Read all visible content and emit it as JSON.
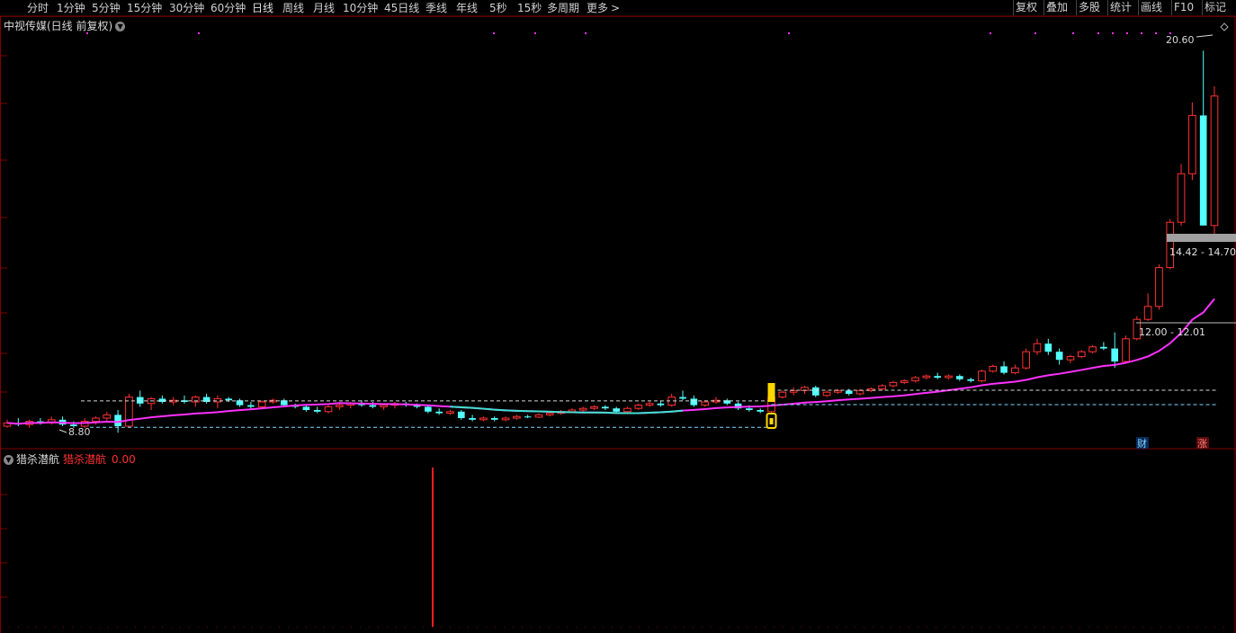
{
  "toolbar": {
    "periods": [
      "分时",
      "1分钟",
      "5分钟",
      "15分钟",
      "30分钟",
      "60分钟",
      "日线",
      "周线",
      "月线",
      "10分钟",
      "45日线",
      "季线",
      "年线",
      "5秒",
      "15秒",
      "多周期",
      "更多"
    ],
    "active_period": "日线",
    "more_chevron": ">",
    "right_buttons": [
      "复权",
      "叠加",
      "多股",
      "统计",
      "画线",
      "F10",
      "标记"
    ]
  },
  "chart": {
    "title": "中视传媒(日线 前复权)"
  },
  "indicator": {
    "name": "猎杀潜航",
    "value_label": "猎杀潜航",
    "value": "0.00"
  },
  "colors": {
    "up": "#ff3232",
    "down": "#54ffff",
    "ma_line": "#ff30ff",
    "ma_line_alt": "#40e0d0",
    "grid": "#800000",
    "dashed_white": "#d8d8d8",
    "dashed_cyan": "#7fd8ff",
    "signal_yellow": "#ffd700",
    "range_box": "#a0a0a0",
    "indicator_bar": "#ff2020"
  },
  "chart_data": {
    "type": "candlestick",
    "annotations": {
      "high_label": "20.60",
      "low_label": "8.80",
      "range_upper": "14.42 - 14.70",
      "range_lower": "12.00 - 12.01",
      "marker_cai": "财",
      "marker_zhang": "涨"
    },
    "price_range": [
      8.5,
      21.0
    ],
    "ohlc": [
      [
        9.0,
        9.2,
        8.95,
        9.1
      ],
      [
        9.1,
        9.25,
        9.0,
        9.05
      ],
      [
        9.05,
        9.2,
        8.95,
        9.15
      ],
      [
        9.15,
        9.25,
        9.05,
        9.1
      ],
      [
        9.1,
        9.3,
        9.05,
        9.2
      ],
      [
        9.2,
        9.3,
        9.0,
        9.05
      ],
      [
        9.05,
        9.15,
        8.95,
        9.0
      ],
      [
        9.0,
        9.25,
        8.95,
        9.15
      ],
      [
        9.15,
        9.3,
        9.05,
        9.25
      ],
      [
        9.25,
        9.45,
        9.15,
        9.35
      ],
      [
        9.35,
        9.5,
        8.8,
        9.0
      ],
      [
        9.0,
        10.0,
        8.95,
        9.9
      ],
      [
        9.9,
        10.1,
        9.6,
        9.7
      ],
      [
        9.7,
        9.9,
        9.5,
        9.85
      ],
      [
        9.85,
        9.95,
        9.7,
        9.75
      ],
      [
        9.75,
        9.9,
        9.65,
        9.8
      ],
      [
        9.8,
        9.95,
        9.7,
        9.75
      ],
      [
        9.75,
        9.95,
        9.6,
        9.9
      ],
      [
        9.9,
        10.0,
        9.7,
        9.75
      ],
      [
        9.75,
        9.95,
        9.55,
        9.85
      ],
      [
        9.85,
        9.9,
        9.75,
        9.8
      ],
      [
        9.8,
        9.85,
        9.6,
        9.65
      ],
      [
        9.65,
        9.75,
        9.5,
        9.6
      ],
      [
        9.6,
        9.8,
        9.55,
        9.75
      ],
      [
        9.75,
        9.85,
        9.7,
        9.8
      ],
      [
        9.8,
        9.85,
        9.6,
        9.65
      ],
      [
        9.65,
        9.7,
        9.55,
        9.6
      ],
      [
        9.6,
        9.65,
        9.45,
        9.5
      ],
      [
        9.5,
        9.6,
        9.4,
        9.45
      ],
      [
        9.45,
        9.65,
        9.4,
        9.6
      ],
      [
        9.6,
        9.7,
        9.5,
        9.65
      ],
      [
        9.65,
        9.75,
        9.55,
        9.7
      ],
      [
        9.7,
        9.8,
        9.6,
        9.65
      ],
      [
        9.65,
        9.75,
        9.55,
        9.6
      ],
      [
        9.6,
        9.7,
        9.5,
        9.65
      ],
      [
        9.65,
        9.75,
        9.55,
        9.7
      ],
      [
        9.7,
        9.75,
        9.6,
        9.65
      ],
      [
        9.65,
        9.7,
        9.55,
        9.6
      ],
      [
        9.6,
        9.65,
        9.4,
        9.45
      ],
      [
        9.45,
        9.55,
        9.35,
        9.4
      ],
      [
        9.4,
        9.5,
        9.35,
        9.45
      ],
      [
        9.45,
        9.5,
        9.2,
        9.25
      ],
      [
        9.25,
        9.35,
        9.15,
        9.2
      ],
      [
        9.2,
        9.3,
        9.15,
        9.25
      ],
      [
        9.25,
        9.3,
        9.15,
        9.2
      ],
      [
        9.2,
        9.3,
        9.15,
        9.25
      ],
      [
        9.25,
        9.35,
        9.2,
        9.3
      ],
      [
        9.3,
        9.35,
        9.25,
        9.28
      ],
      [
        9.28,
        9.4,
        9.25,
        9.35
      ],
      [
        9.35,
        9.45,
        9.3,
        9.4
      ],
      [
        9.4,
        9.5,
        9.35,
        9.45
      ],
      [
        9.45,
        9.55,
        9.4,
        9.5
      ],
      [
        9.5,
        9.6,
        9.45,
        9.55
      ],
      [
        9.55,
        9.65,
        9.5,
        9.6
      ],
      [
        9.6,
        9.65,
        9.5,
        9.55
      ],
      [
        9.55,
        9.6,
        9.4,
        9.45
      ],
      [
        9.45,
        9.6,
        9.4,
        9.55
      ],
      [
        9.55,
        9.7,
        9.5,
        9.65
      ],
      [
        9.65,
        9.75,
        9.6,
        9.7
      ],
      [
        9.7,
        9.8,
        9.6,
        9.65
      ],
      [
        9.65,
        10.0,
        9.6,
        9.9
      ],
      [
        9.9,
        10.1,
        9.8,
        9.85
      ],
      [
        9.85,
        9.95,
        9.6,
        9.65
      ],
      [
        9.65,
        9.8,
        9.6,
        9.75
      ],
      [
        9.75,
        9.9,
        9.7,
        9.8
      ],
      [
        9.8,
        9.85,
        9.65,
        9.7
      ],
      [
        9.7,
        9.75,
        9.5,
        9.55
      ],
      [
        9.55,
        9.65,
        9.45,
        9.5
      ],
      [
        9.5,
        9.55,
        9.4,
        9.45
      ],
      [
        9.45,
        9.95,
        9.0,
        9.9
      ],
      [
        9.9,
        10.1,
        9.85,
        10.05
      ],
      [
        10.05,
        10.2,
        9.95,
        10.1
      ],
      [
        10.1,
        10.25,
        10.0,
        10.2
      ],
      [
        10.2,
        10.25,
        9.9,
        9.95
      ],
      [
        9.95,
        10.1,
        9.9,
        10.05
      ],
      [
        10.05,
        10.15,
        10.0,
        10.1
      ],
      [
        10.1,
        10.15,
        9.95,
        10.0
      ],
      [
        10.0,
        10.15,
        9.95,
        10.1
      ],
      [
        10.1,
        10.2,
        10.05,
        10.15
      ],
      [
        10.15,
        10.3,
        10.1,
        10.25
      ],
      [
        10.25,
        10.4,
        10.2,
        10.35
      ],
      [
        10.35,
        10.45,
        10.3,
        10.4
      ],
      [
        10.4,
        10.55,
        10.35,
        10.5
      ],
      [
        10.5,
        10.6,
        10.45,
        10.55
      ],
      [
        10.55,
        10.65,
        10.45,
        10.5
      ],
      [
        10.5,
        10.6,
        10.45,
        10.55
      ],
      [
        10.55,
        10.6,
        10.4,
        10.45
      ],
      [
        10.45,
        10.5,
        10.35,
        10.4
      ],
      [
        10.4,
        10.75,
        10.35,
        10.7
      ],
      [
        10.7,
        10.9,
        10.65,
        10.85
      ],
      [
        10.85,
        11.0,
        10.6,
        10.65
      ],
      [
        10.65,
        10.9,
        10.6,
        10.8
      ],
      [
        10.8,
        11.4,
        10.75,
        11.3
      ],
      [
        11.3,
        11.7,
        11.2,
        11.55
      ],
      [
        11.55,
        11.7,
        11.2,
        11.3
      ],
      [
        11.3,
        11.4,
        10.9,
        11.05
      ],
      [
        11.05,
        11.2,
        10.95,
        11.15
      ],
      [
        11.15,
        11.35,
        11.1,
        11.3
      ],
      [
        11.3,
        11.5,
        11.25,
        11.45
      ],
      [
        11.45,
        11.6,
        11.35,
        11.4
      ],
      [
        11.4,
        11.9,
        10.8,
        11.0
      ],
      [
        11.0,
        11.8,
        10.95,
        11.7
      ],
      [
        11.7,
        12.4,
        11.65,
        12.3
      ],
      [
        12.3,
        13.1,
        12.25,
        12.7
      ],
      [
        12.7,
        14.0,
        12.6,
        13.9
      ],
      [
        13.9,
        15.4,
        13.85,
        15.3
      ],
      [
        15.3,
        17.1,
        15.2,
        16.8
      ],
      [
        16.8,
        19.0,
        16.6,
        18.6
      ],
      [
        18.6,
        20.6,
        15.2,
        15.2
      ],
      [
        15.2,
        19.5,
        14.8,
        19.2
      ]
    ],
    "ma_series_label": "",
    "signal_levels": [
      9.78,
      10.14
    ],
    "support_levels": [
      9.05
    ],
    "indicator_signal_index": 38,
    "indicator_range": [
      0,
      1
    ]
  }
}
